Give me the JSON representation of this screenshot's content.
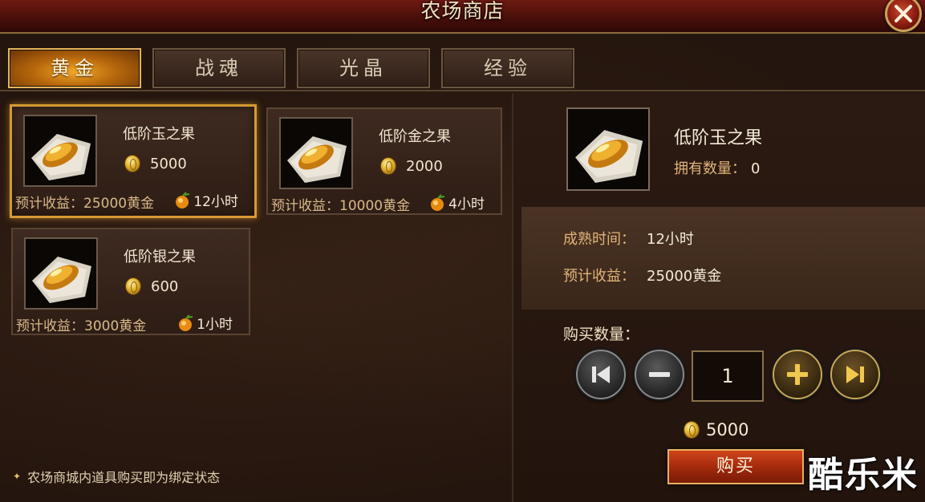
{
  "window": {
    "title": "农场商店"
  },
  "tabs": [
    {
      "label": "黄金",
      "active": true
    },
    {
      "label": "战魂",
      "active": false
    },
    {
      "label": "光晶",
      "active": false
    },
    {
      "label": "经验",
      "active": false
    }
  ],
  "items": [
    {
      "name": "低阶玉之果",
      "price": "5000",
      "income": "预计收益：25000黄金",
      "time": "12小时",
      "selected": true
    },
    {
      "name": "低阶金之果",
      "price": "2000",
      "income": "预计收益：10000黄金",
      "time": "4小时",
      "selected": false
    },
    {
      "name": "低阶银之果",
      "price": "600",
      "income": "预计收益：3000黄金",
      "time": "1小时",
      "selected": false
    }
  ],
  "notice": "农场商城内道具购买即为绑定状态",
  "detail": {
    "name": "低阶玉之果",
    "owned_label": "拥有数量：",
    "owned_value": "0",
    "mature_label": "成熟时间：",
    "mature_value": "12小时",
    "income_label": "预计收益：",
    "income_value": "25000黄金",
    "quantity_label": "购买数量：",
    "quantity": "1",
    "total": "5000",
    "buy_label": "购买"
  },
  "watermark": "酷乐米",
  "icons": {
    "close": "close-icon",
    "coin": "gold-coin-icon",
    "fruit": "fruit-icon",
    "first": "skip-first-icon",
    "minus": "minus-icon",
    "plus": "plus-icon",
    "last": "skip-last-icon"
  }
}
